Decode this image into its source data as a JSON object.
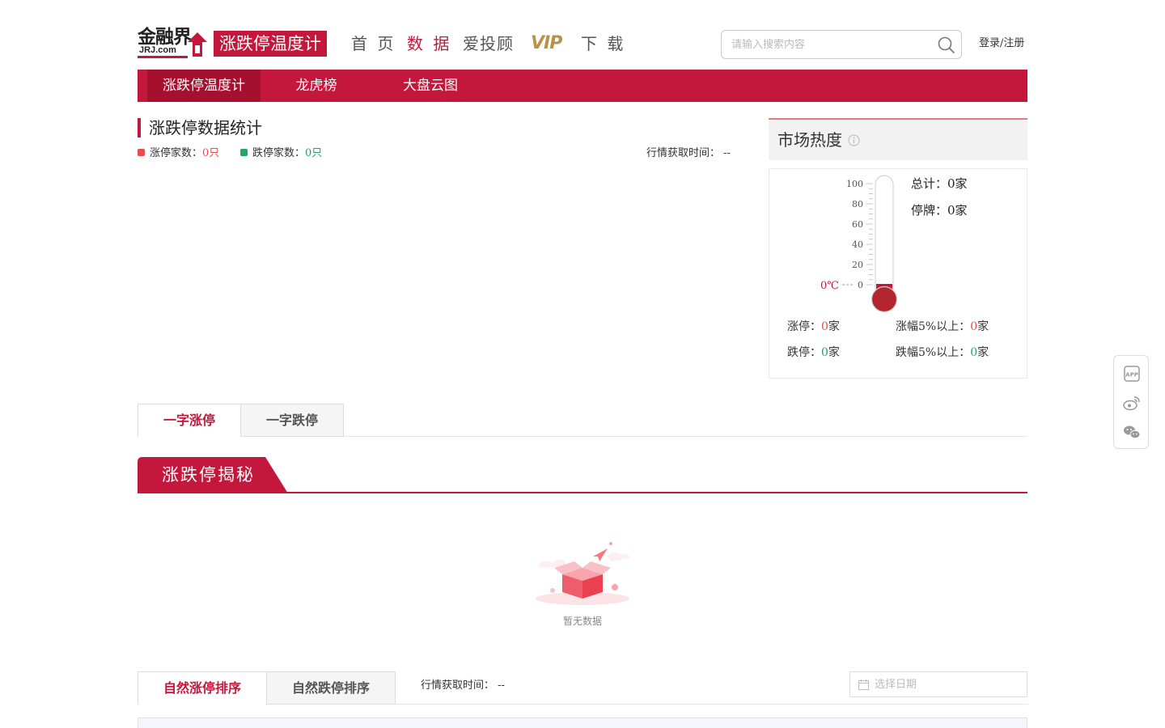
{
  "header": {
    "logo_main": "金融界",
    "logo_sub": "JRJ.com",
    "brand_tag": "涨跌停温度计",
    "nav": [
      {
        "label": "首 页",
        "active": false
      },
      {
        "label": "数 据",
        "active": true
      },
      {
        "label": "爱投顾",
        "active": false
      },
      {
        "label": "VIP",
        "active": false
      },
      {
        "label": "下 载",
        "active": false
      }
    ],
    "search_placeholder": "请输入搜索内容",
    "login_label": "登录/注册"
  },
  "tabbar": {
    "items": [
      {
        "label": "涨跌停温度计",
        "active": true
      },
      {
        "label": "龙虎榜",
        "active": false
      },
      {
        "label": "大盘云图",
        "active": false
      }
    ]
  },
  "stats": {
    "title": "涨跌停数据统计",
    "limit_up_label": "涨停家数：",
    "limit_up_value": "0只",
    "limit_down_label": "跌停家数：",
    "limit_down_value": "0只",
    "fetch_time_label": "行情获取时间：",
    "fetch_time_value": "--"
  },
  "market_heat": {
    "title": "市场热度",
    "temperature_reading": "0℃",
    "temperature_value": 0,
    "scale_labels": [
      "100",
      "80",
      "60",
      "40",
      "20",
      "0"
    ],
    "total_label": "总计：",
    "total_value": "0家",
    "suspended_label": "停牌：",
    "suspended_value": "0家",
    "limit_up_label": "涨停：",
    "limit_up_num": "0",
    "limit_up_unit": "家",
    "rise5_label": "涨幅5%以上：",
    "rise5_num": "0",
    "rise5_unit": "家",
    "limit_down_label": "跌停：",
    "limit_down_num": "0",
    "limit_down_unit": "家",
    "fall5_label": "跌幅5%以上：",
    "fall5_num": "0",
    "fall5_unit": "家"
  },
  "word_tabs": [
    {
      "label": "一字涨停",
      "active": true
    },
    {
      "label": "一字跌停",
      "active": false
    }
  ],
  "reveal": {
    "title": "涨跌停揭秘",
    "empty_text": "暂无数据"
  },
  "sort_section": {
    "tabs": [
      {
        "label": "自然涨停排序",
        "active": true
      },
      {
        "label": "自然跌停排序",
        "active": false
      }
    ],
    "fetch_time_label": "行情获取时间：",
    "fetch_time_value": "--",
    "date_placeholder": "选择日期"
  },
  "side_tools": [
    "app-icon",
    "weibo-icon",
    "wechat-icon"
  ],
  "colors": {
    "brand_red": "#c3173b",
    "up_red": "#e84d4d",
    "down_green": "#20a56b",
    "vip_gold": "#b8924b"
  }
}
